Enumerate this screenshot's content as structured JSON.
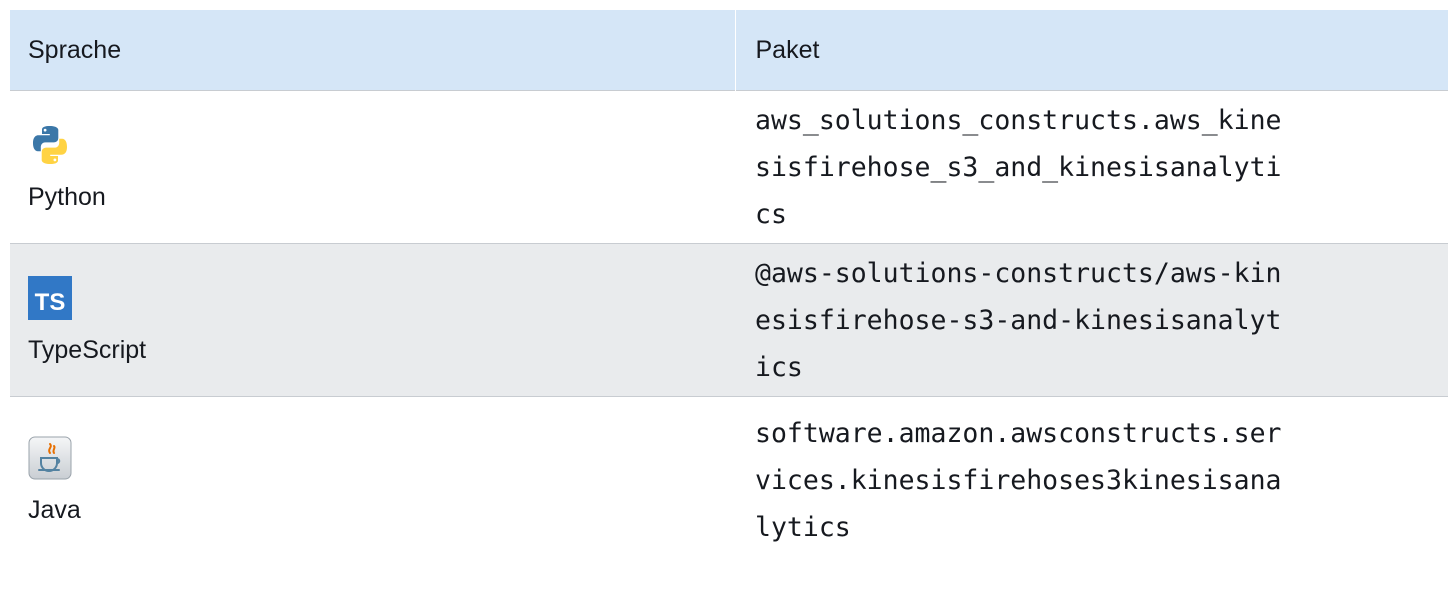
{
  "table": {
    "headers": {
      "language": "Sprache",
      "package": "Paket"
    },
    "rows": [
      {
        "icon": "python-icon",
        "language": "Python",
        "package": "aws_solutions_constructs.aws_kinesisfirehose_s3_and_kinesisanalytics"
      },
      {
        "icon": "typescript-icon",
        "language": "TypeScript",
        "package": "@aws-solutions-constructs/aws-kinesisfirehose-s3-and-kinesisanalytics"
      },
      {
        "icon": "java-icon",
        "language": "Java",
        "package": "software.amazon.awsconstructs.services.kinesisfirehoses3kinesisanalytics"
      }
    ]
  },
  "colors": {
    "header_bg": "#d5e6f7",
    "alt_row_bg": "#e9ebed",
    "typescript_blue": "#3178c6"
  }
}
